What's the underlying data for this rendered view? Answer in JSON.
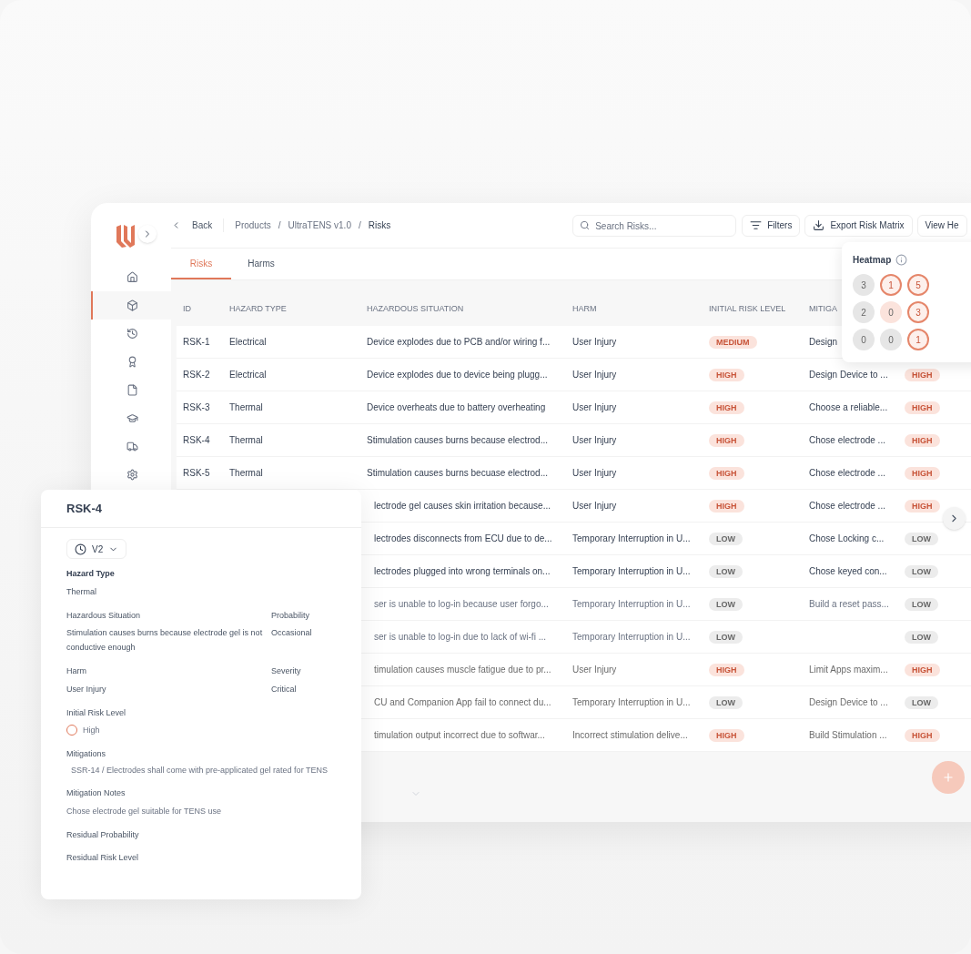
{
  "header": {
    "back": "Back",
    "separator": "/",
    "breadcrumb": [
      {
        "label": "Products",
        "current": false
      },
      {
        "label": "UltraTENS v1.0",
        "current": false
      },
      {
        "label": "Risks",
        "current": true
      }
    ],
    "search": {
      "placeholder": "Search Risks..."
    },
    "buttons": [
      {
        "kind": "filter",
        "label": "Filters"
      },
      {
        "kind": "export",
        "label": "Export Risk Matrix"
      },
      {
        "kind": "plain",
        "label": "View He"
      }
    ]
  },
  "sidebar": {
    "items": [
      {
        "kind": "home",
        "selected": false
      },
      {
        "kind": "box",
        "selected": true
      },
      {
        "kind": "history",
        "selected": false
      },
      {
        "kind": "award",
        "selected": false
      },
      {
        "kind": "file",
        "selected": false
      },
      {
        "kind": "cap",
        "selected": false
      },
      {
        "kind": "truck",
        "selected": false
      },
      {
        "kind": "gear",
        "selected": false
      }
    ]
  },
  "tabs": [
    {
      "label": "Risks",
      "selected": true
    },
    {
      "label": "Harms",
      "selected": false
    }
  ],
  "table": {
    "columns": [
      "ID",
      "HAZARD TYPE",
      "HAZARDOUS SITUATION",
      "HARM",
      "INITIAL RISK LEVEL",
      "MITIGA"
    ],
    "rows": [
      {
        "id": "RSK-1",
        "hazard_type": "Electrical",
        "situation": "Device explodes due to PCB and/or wiring f...",
        "harm": "User Injury",
        "initial": {
          "label": "MEDIUM",
          "kind": "medium"
        },
        "mitigation": "Design"
      },
      {
        "id": "RSK-2",
        "hazard_type": "Electrical",
        "situation": "Device explodes due to device being plugg...",
        "harm": "User Injury",
        "initial": {
          "label": "HIGH",
          "kind": "high"
        },
        "mitigation": "Design Device to ...",
        "residual": {
          "label": "HIGH",
          "kind": "high"
        }
      },
      {
        "id": "RSK-3",
        "hazard_type": "Thermal",
        "situation": "Device overheats due to battery overheating",
        "harm": "User Injury",
        "initial": {
          "label": "HIGH",
          "kind": "high"
        },
        "mitigation": "Choose a reliable...",
        "residual": {
          "label": "HIGH",
          "kind": "high"
        }
      },
      {
        "id": "RSK-4",
        "hazard_type": "Thermal",
        "situation": "Stimulation causes burns because electrod...",
        "harm": "User Injury",
        "initial": {
          "label": "HIGH",
          "kind": "high"
        },
        "mitigation": "Chose electrode ...",
        "residual": {
          "label": "HIGH",
          "kind": "high"
        }
      },
      {
        "id": "RSK-5",
        "hazard_type": "Thermal",
        "situation": "Stimulation causes burns becuase electrod...",
        "harm": "User Injury",
        "initial": {
          "label": "HIGH",
          "kind": "high"
        },
        "mitigation": "Chose electrode ...",
        "residual": {
          "label": "HIGH",
          "kind": "high"
        }
      },
      {
        "situation": "lectrode gel causes skin irritation because...",
        "harm": "User Injury",
        "initial": {
          "label": "HIGH",
          "kind": "high"
        },
        "mitigation": "Chose electrode ...",
        "residual": {
          "label": "HIGH",
          "kind": "high"
        }
      },
      {
        "situation": "lectrodes disconnects from ECU due to de...",
        "harm": "Temporary Interruption in U...",
        "initial": {
          "label": "LOW",
          "kind": "low"
        },
        "mitigation": "Chose Locking c...",
        "residual": {
          "label": "LOW",
          "kind": "low"
        }
      },
      {
        "situation": "lectrodes plugged into wrong terminals on...",
        "harm": "Temporary Interruption in U...",
        "initial": {
          "label": "LOW",
          "kind": "low"
        },
        "mitigation": "Chose keyed con...",
        "residual": {
          "label": "LOW",
          "kind": "low"
        }
      },
      {
        "situation": "ser is unable to log-in because user forgo...",
        "harm": "Temporary Interruption in U...",
        "initial": {
          "label": "LOW",
          "kind": "low"
        },
        "mitigation": "Build a reset pass...",
        "residual": {
          "label": "LOW",
          "kind": "low"
        }
      },
      {
        "situation": "ser is unable to log-in due to lack of wi-fi ...",
        "harm": "Temporary Interruption in U...",
        "initial": {
          "label": "LOW",
          "kind": "low"
        },
        "residual": {
          "label": "LOW",
          "kind": "low"
        }
      },
      {
        "situation": "timulation causes muscle fatigue due to pr...",
        "harm": "User Injury",
        "initial": {
          "label": "HIGH",
          "kind": "high"
        },
        "mitigation": "Limit Apps maxim...",
        "residual": {
          "label": "HIGH",
          "kind": "high"
        }
      },
      {
        "situation": "CU and Companion App fail to connect du...",
        "harm": "Temporary Interruption in U...",
        "initial": {
          "label": "LOW",
          "kind": "low"
        },
        "mitigation": "Design Device to ...",
        "residual": {
          "label": "LOW",
          "kind": "low"
        }
      },
      {
        "situation": "timulation output incorrect due to softwar...",
        "harm": "Incorrect stimulation delive...",
        "initial": {
          "label": "HIGH",
          "kind": "high"
        },
        "mitigation": "Build Stimulation ...",
        "residual": {
          "label": "HIGH",
          "kind": "high"
        }
      }
    ]
  },
  "heatmap": {
    "title": "Heatmap",
    "cells": [
      [
        {
          "value": "3",
          "kind": "neutral"
        },
        {
          "value": "1",
          "kind": "high"
        },
        {
          "value": "5",
          "kind": "high"
        }
      ],
      [
        {
          "value": "2",
          "kind": "neutral"
        },
        {
          "value": "0",
          "kind": "medium"
        },
        {
          "value": "3",
          "kind": "high"
        }
      ],
      [
        {
          "value": "0",
          "kind": "neutral"
        },
        {
          "value": "0",
          "kind": "neutral"
        },
        {
          "value": "1",
          "kind": "high"
        }
      ]
    ]
  },
  "detail": {
    "title": "RSK-4",
    "version": "V2",
    "fields": [
      {
        "kind": "full",
        "label": "Hazard Type",
        "value": "Thermal"
      },
      {
        "kind": "pair",
        "label": "Hazardous Situation",
        "value": "Stimulation causes burns because electrode gel is not conductive enough",
        "label2": "Probability",
        "value2": "Occasional"
      },
      {
        "kind": "pair",
        "label": "Harm",
        "value": "User Injury",
        "label2": "Severity",
        "value2": "Critical"
      },
      {
        "kind": "risk",
        "label": "Initial Risk Level",
        "value": "High"
      },
      {
        "kind": "chip",
        "label": "Mitigations",
        "value": "SSR-14 / Electrodes shall come with pre-applicated gel rated for TENS"
      },
      {
        "kind": "full",
        "label": "Mitigation Notes",
        "value": "Chose electrode gel suitable for TENS use"
      },
      {
        "kind": "full",
        "label": "Residual Probability"
      },
      {
        "kind": "full",
        "label": "Residual Risk Level"
      }
    ]
  }
}
